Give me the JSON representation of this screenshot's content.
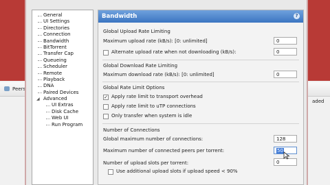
{
  "background": {
    "peers_tab": "Peers",
    "right_fragment": "aded"
  },
  "tree": {
    "items": [
      {
        "label": "General",
        "level": 1
      },
      {
        "label": "UI Settings",
        "level": 1
      },
      {
        "label": "Directories",
        "level": 1
      },
      {
        "label": "Connection",
        "level": 1
      },
      {
        "label": "Bandwidth",
        "level": 1
      },
      {
        "label": "BitTorrent",
        "level": 1
      },
      {
        "label": "Transfer Cap",
        "level": 1
      },
      {
        "label": "Queueing",
        "level": 1
      },
      {
        "label": "Scheduler",
        "level": 1
      },
      {
        "label": "Remote",
        "level": 1
      },
      {
        "label": "Playback",
        "level": 1
      },
      {
        "label": "DNA",
        "level": 1
      },
      {
        "label": "Paired Devices",
        "level": 1
      },
      {
        "label": "Advanced",
        "level": 1,
        "expanded": true
      },
      {
        "label": "UI Extras",
        "level": 2
      },
      {
        "label": "Disk Cache",
        "level": 2
      },
      {
        "label": "Web UI",
        "level": 2
      },
      {
        "label": "Run Program",
        "level": 2
      }
    ]
  },
  "pane": {
    "title": "Bandwidth",
    "help_icon": "?",
    "upload": {
      "section": "Global Upload Rate Limiting",
      "max_label": "Maximum upload rate (kB/s): [0: unlimited]",
      "max_value": "0",
      "alt_label": "Alternate upload rate when not downloading (kB/s):",
      "alt_checked": false,
      "alt_value": "0"
    },
    "download": {
      "section": "Global Download Rate Limiting",
      "max_label": "Maximum download rate (kB/s): [0: unlimited]",
      "max_value": "0"
    },
    "options": {
      "section": "Global Rate Limit Options",
      "overhead_label": "Apply rate limit to transport overhead",
      "overhead_checked": true,
      "utp_label": "Apply rate limit to uTP connections",
      "utp_checked": false,
      "idle_label": "Only transfer when system is idle",
      "idle_checked": false
    },
    "connections": {
      "section": "Number of Connections",
      "global_label": "Global maximum number of connections:",
      "global_value": "128",
      "peers_label": "Maximum number of connected peers per torrent:",
      "peers_value": "50",
      "slots_label": "Number of upload slots per torrent:",
      "slots_value": "0",
      "extra_label": "Use additional upload slots if upload speed < 90%",
      "extra_checked": false
    }
  },
  "colors": {
    "header_top": "#6fa1dd",
    "header_bottom": "#3b75c1",
    "frame": "#b83a36"
  }
}
